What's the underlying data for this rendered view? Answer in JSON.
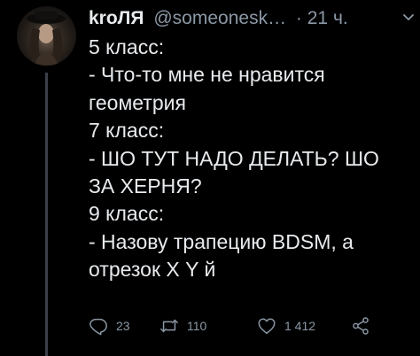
{
  "tweet": {
    "author_name": "kroЛЯ",
    "handle": "@someonesk…",
    "time": "· 21 ч.",
    "lines": [
      "5 класс:",
      "- Что-то мне не нравится",
      "геометрия",
      "7 класс:",
      "- ШО ТУТ НАДО ДЕЛАТЬ? ШО",
      "ЗА ХЕРНЯ?",
      "9 класс:",
      "- Назову трапецию BDSM, а",
      "отрезок Х Y й"
    ],
    "stats": {
      "replies": "23",
      "retweets": "110",
      "likes": "1 412"
    }
  },
  "icons": {
    "reply": "reply-icon",
    "retweet": "retweet-icon",
    "like": "heart-icon",
    "share": "share-icon",
    "menu": "chevron-down-icon"
  },
  "colors": {
    "background": "#000000",
    "text": "#e8ebee",
    "secondary": "#8b98a5",
    "thread_line": "#3b4148"
  }
}
